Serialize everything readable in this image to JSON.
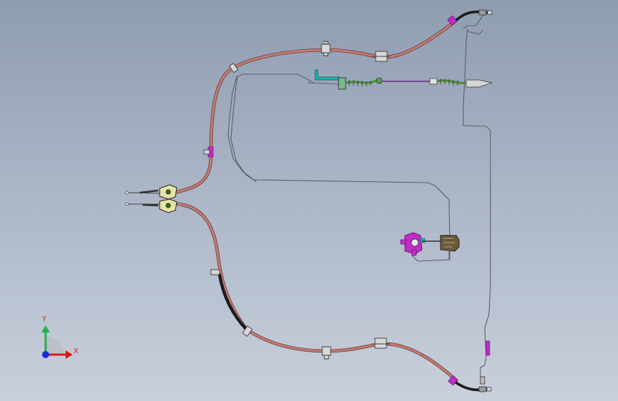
{
  "triad": {
    "x_label": "X",
    "y_label": "Y"
  },
  "colors": {
    "background_top": "#8f9db1",
    "background_bottom": "#c9d0dc",
    "brake_cable": "#b9706a",
    "brake_cable_dark": "#1c1c1c",
    "brake_line": "#5c5e66",
    "clip": "#d8d8d8",
    "clip_outline": "#3a3a3a",
    "hose_green": "#4f8a3a",
    "fitting_purple": "#c22cc8",
    "fitting_teal": "#19b4b0",
    "axis_x": "#d61a1a",
    "axis_y": "#22b04a",
    "axis_z": "#1a2cd6"
  }
}
